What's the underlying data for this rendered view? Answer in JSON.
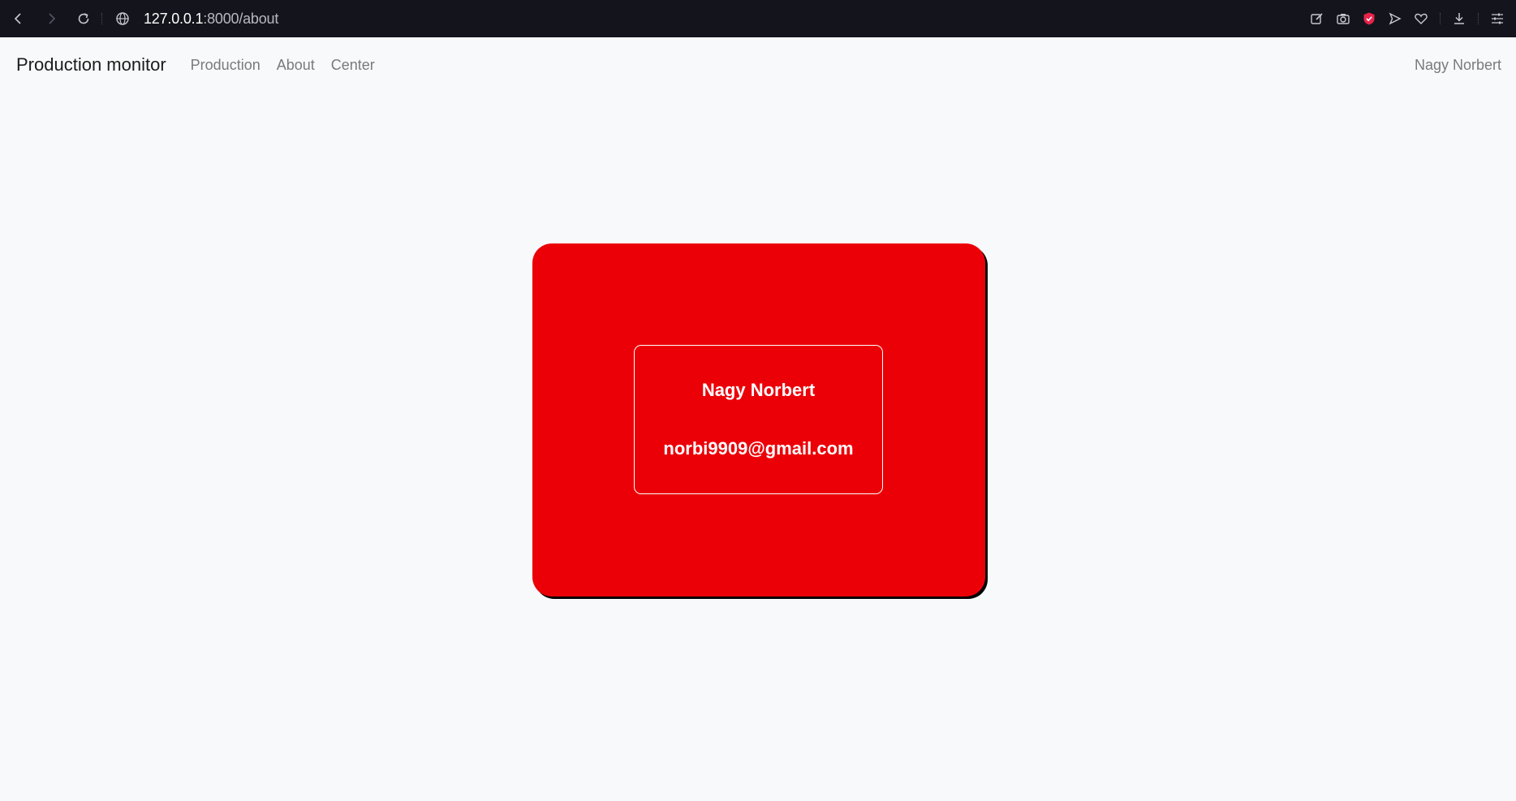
{
  "browser": {
    "url_host": "127.0.0.1",
    "url_path": ":8000/about"
  },
  "navbar": {
    "brand": "Production monitor",
    "links": [
      "Production",
      "About",
      "Center"
    ],
    "user": "Nagy Norbert"
  },
  "card": {
    "name": "Nagy Norbert",
    "email": "norbi9909@gmail.com"
  },
  "colors": {
    "card_background": "#ec0008",
    "browser_chrome": "#14141c",
    "page_background": "#f8f9fa",
    "shield_accent": "#e8234a"
  }
}
